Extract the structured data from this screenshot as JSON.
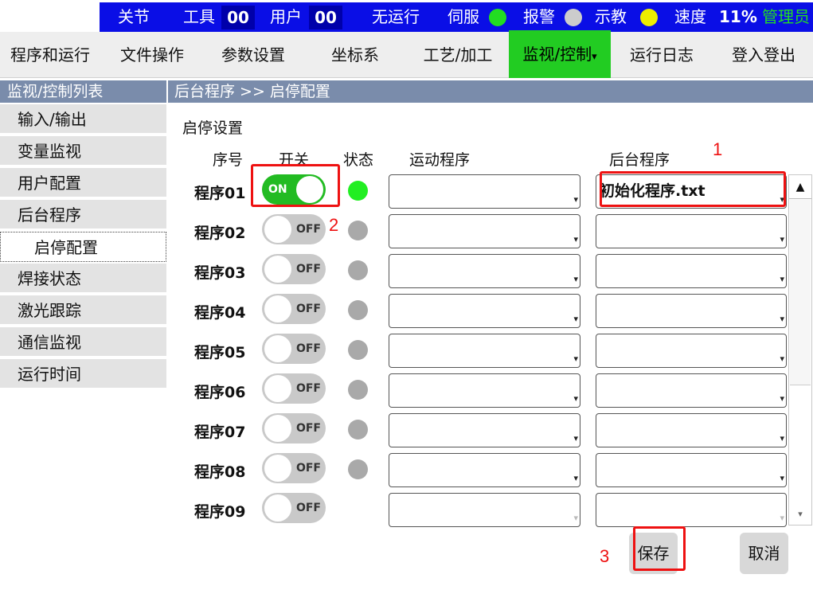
{
  "status_bar": {
    "close_label": "关节",
    "tool_label": "工具",
    "tool_value": "00",
    "user_label": "用户",
    "user_value": "00",
    "run_status": "无运行",
    "servo_label": "伺服",
    "alarm_label": "报警",
    "teach_label": "示教",
    "speed_label": "速度",
    "speed_value": "11%",
    "admin_label": "管理员",
    "colors": {
      "servo": "#22dd22",
      "alarm": "#cccccc",
      "teach": "#eeee00"
    }
  },
  "menu": {
    "items": [
      {
        "label": "程序和运行"
      },
      {
        "label": "文件操作"
      },
      {
        "label": "参数设置"
      },
      {
        "label": "坐标系"
      },
      {
        "label": "工艺/加工"
      },
      {
        "label": "监视/控制",
        "caret": "▾",
        "active": true
      },
      {
        "label": "运行日志"
      },
      {
        "label": "登入登出"
      }
    ]
  },
  "sidebar": {
    "title": "监视/控制列表",
    "items": [
      {
        "label": "输入/输出"
      },
      {
        "label": "变量监视"
      },
      {
        "label": "用户配置"
      },
      {
        "label": "后台程序"
      },
      {
        "label": "启停配置",
        "sub": true,
        "selected": true
      },
      {
        "label": "焊接状态"
      },
      {
        "label": "激光跟踪"
      },
      {
        "label": "通信监视"
      },
      {
        "label": "运行时间"
      }
    ]
  },
  "breadcrumb": "后台程序 >> 启停配置",
  "section_title": "启停设置",
  "columns": {
    "index": "序号",
    "switch": "开关",
    "status": "状态",
    "motion_program": "运动程序",
    "background_program": "后台程序"
  },
  "rows": [
    {
      "label": "程序01",
      "toggle": "ON",
      "status": "green",
      "motion": "",
      "background": "初始化程序.txt"
    },
    {
      "label": "程序02",
      "toggle": "OFF",
      "status": "gray",
      "motion": "",
      "background": ""
    },
    {
      "label": "程序03",
      "toggle": "OFF",
      "status": "gray",
      "motion": "",
      "background": ""
    },
    {
      "label": "程序04",
      "toggle": "OFF",
      "status": "gray",
      "motion": "",
      "background": ""
    },
    {
      "label": "程序05",
      "toggle": "OFF",
      "status": "gray",
      "motion": "",
      "background": ""
    },
    {
      "label": "程序06",
      "toggle": "OFF",
      "status": "gray",
      "motion": "",
      "background": ""
    },
    {
      "label": "程序07",
      "toggle": "OFF",
      "status": "gray",
      "motion": "",
      "background": ""
    },
    {
      "label": "程序08",
      "toggle": "OFF",
      "status": "gray",
      "motion": "",
      "background": ""
    },
    {
      "label": "程序09",
      "toggle": "OFF",
      "status": "none",
      "motion": "",
      "background": ""
    }
  ],
  "buttons": {
    "save": "保存",
    "cancel": "取消"
  },
  "annotations": {
    "step1": "1",
    "step2": "2",
    "step3": "3"
  },
  "icons": {
    "dropdown": "chevron-down-icon",
    "scroll_up": "▲",
    "scroll_down": "▾"
  }
}
